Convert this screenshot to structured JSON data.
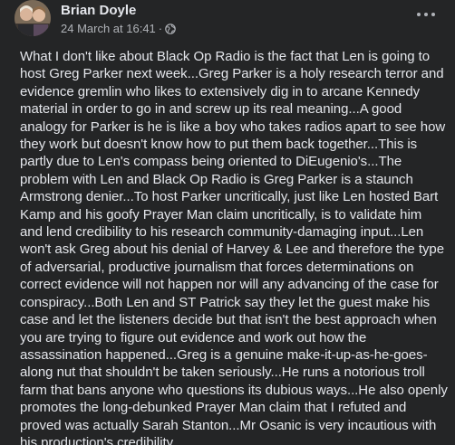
{
  "post": {
    "author_name": "Brian Doyle",
    "timestamp": "24 March at 16:41",
    "separator": "·",
    "privacy_icon": "globe-icon",
    "more_icon": "more-horizontal-icon",
    "text": "What I don't like about Black Op Radio is the fact that Len is going to host Greg Parker next week...Greg Parker is a holy research terror and evidence gremlin who likes to extensively dig in to arcane Kennedy material in order to go in and screw up its real meaning...A good analogy for Parker is he is like a boy who takes radios apart to see how they work but doesn't know how to put them back together...This is partly due to Len's compass being oriented to DiEugenio's...The problem with Len and Black Op Radio is Greg Parker is a staunch Armstrong denier...To host Parker uncritically, just like Len hosted Bart Kamp and his goofy Prayer Man claim uncritically, is to validate him and lend credibility to his research community-damaging input...Len won't ask Greg about his denial of Harvey & Lee and therefore the type of adversarial, productive journalism that forces determinations on correct evidence will not happen nor will any advancing of the case for conspiracy...Both Len and ST Patrick say they let the guest make his case and let the listeners decide but that isn't the best approach when you are trying to figure out evidence and work out how the assassination happened...Greg is a genuine make-it-up-as-he-goes-along nut that shouldn't be taken seriously...He runs a notorious troll farm that bans anyone who questions its dubious ways...He also openly promotes the long-debunked Prayer Man claim that I refuted and proved was actually Sarah Stanton...Mr Osanic is very incautious with his production's credibility..."
  }
}
